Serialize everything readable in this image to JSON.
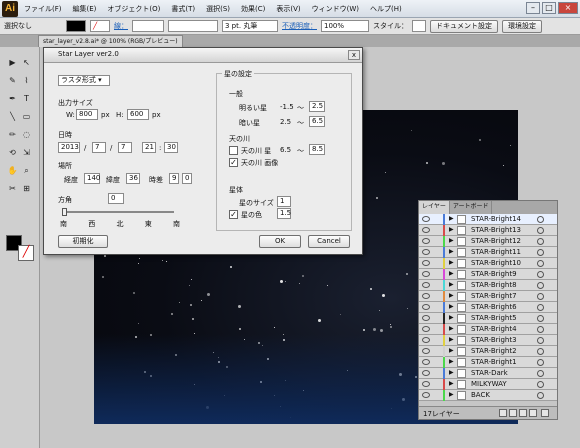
{
  "app": {
    "logo": "Ai"
  },
  "menu": [
    "ファイル(F)",
    "編集(E)",
    "オブジェクト(O)",
    "書式(T)",
    "選択(S)",
    "効果(C)",
    "表示(V)",
    "ウィンドウ(W)",
    "ヘルプ(H)"
  ],
  "control_bar": {
    "selection": "選択なし",
    "stroke_label": "線：",
    "stroke_value": "3 pt. 丸筆",
    "opacity_label": "不透明度：",
    "opacity_value": "100%",
    "style_label": "スタイル：",
    "doc_settings": "ドキュメント設定",
    "prefs": "環境設定"
  },
  "document_tab": "star_layer_v2.8.ai* @ 100% (RGB/プレビュー)",
  "dialog": {
    "title": "Star Layer ver2.0",
    "close": "x",
    "format": "ラスタ形式",
    "output_size": "出力サイズ",
    "w_label": "W:",
    "w_value": "800",
    "h_label": "H:",
    "h_value": "600",
    "px": "px",
    "datetime": "日時",
    "year": "2013",
    "month": "7",
    "day": "7",
    "hour": "21",
    "minute": "30",
    "slash": "/",
    "colon": ":",
    "location": "場所",
    "longitude_label": "経度",
    "longitude": "140",
    "latitude_label": "緯度",
    "latitude": "36",
    "timezone_label": "時差",
    "timezone": "9",
    "tz_min": "0",
    "direction": "方角",
    "direction_value": "0",
    "compass": [
      "南",
      "西",
      "北",
      "東",
      "南"
    ],
    "reset": "初期化",
    "star_settings": "星の設定",
    "general": "一般",
    "bright_label": "明るい星",
    "bright_min": "-1.5",
    "bright_max": "2.5",
    "dark_label": "暗い星",
    "dark_min": "2.5",
    "dark_max": "6.5",
    "tilde": "〜",
    "milkyway": "天の川",
    "mw_star_label": "天の川 星",
    "mw_star_min": "6.5",
    "mw_star_max": "8.5",
    "mw_image_label": "天の川 画像",
    "mw_star_checked": false,
    "mw_image_checked": true,
    "stars": "星体",
    "star_size_label": "星のサイズ",
    "star_size": "1",
    "star_color_label": "星の色",
    "star_color_checked": true,
    "star_color": "1.5",
    "ok": "OK",
    "cancel": "Cancel"
  },
  "layers_panel": {
    "tabs": [
      "レイヤー",
      "アートボード"
    ],
    "count": "17レイヤー",
    "layers": [
      {
        "name": "STAR-Bright14",
        "color": "#4a7bd8"
      },
      {
        "name": "STAR-Bright13",
        "color": "#d84a4a"
      },
      {
        "name": "STAR-Bright12",
        "color": "#4ad84a"
      },
      {
        "name": "STAR-Bright11",
        "color": "#4a7bd8"
      },
      {
        "name": "STAR-Bright10",
        "color": "#e0d040"
      },
      {
        "name": "STAR-Bright9",
        "color": "#d84ad8"
      },
      {
        "name": "STAR-Bright8",
        "color": "#4ad8d8"
      },
      {
        "name": "STAR-Bright7",
        "color": "#e08a40"
      },
      {
        "name": "STAR-Bright6",
        "color": "#4a7bd8"
      },
      {
        "name": "STAR-Bright5",
        "color": "#222222"
      },
      {
        "name": "STAR-Bright4",
        "color": "#d84a4a"
      },
      {
        "name": "STAR-Bright3",
        "color": "#e0d040"
      },
      {
        "name": "STAR-Bright2",
        "color": "#d0d0d0"
      },
      {
        "name": "STAR-Bright1",
        "color": "#4ad84a"
      },
      {
        "name": "STAR-Dark",
        "color": "#4a7bd8"
      },
      {
        "name": "MILKYWAY",
        "color": "#d84a4a"
      },
      {
        "name": "BACK",
        "color": "#4ad84a"
      }
    ]
  }
}
